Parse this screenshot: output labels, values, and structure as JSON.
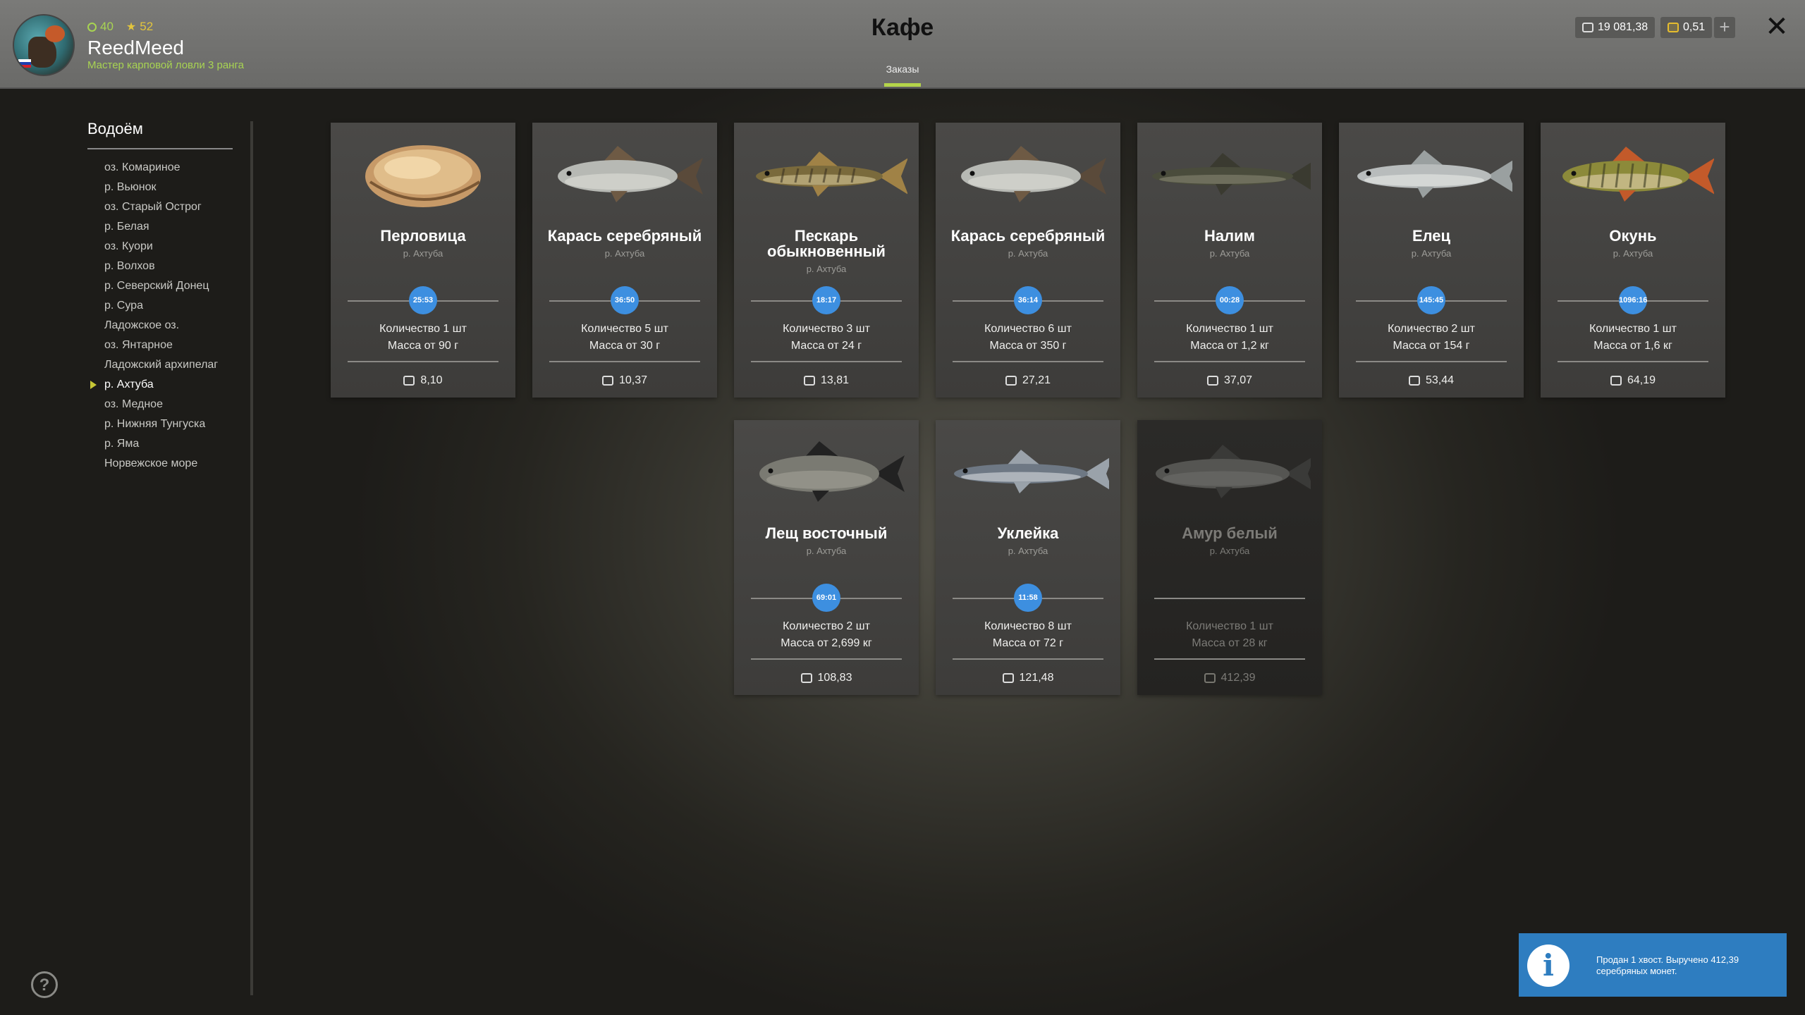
{
  "header": {
    "title": "Кафе",
    "tab_label": "Заказы",
    "player": {
      "level": "40",
      "rating": "52",
      "username": "ReedMeed",
      "rank": "Мастер карповой ловли 3 ранга"
    },
    "silver": "19 081,38",
    "gold": "0,51",
    "plus_label": "+",
    "close_label": "✕"
  },
  "sidebar": {
    "title": "Водоём",
    "items": [
      "оз. Комариное",
      "р. Вьюнок",
      "оз. Старый Острог",
      "р. Белая",
      "оз. Куори",
      "р. Волхов",
      "р. Северский Донец",
      "р. Сура",
      "Ладожское оз.",
      "оз. Янтарное",
      "Ладожский архипелаг",
      "р. Ахтуба",
      "оз. Медное",
      "р. Нижняя Тунгуска",
      "р. Яма",
      "Норвежское море"
    ],
    "active_index": 11
  },
  "orders": [
    {
      "name": "Перловица",
      "location": "р. Ахтуба",
      "timer": "25:53",
      "quantity": "Количество 1 шт",
      "mass": "Масса от 90 г",
      "price": "8,10",
      "image": "mussel-icon"
    },
    {
      "name": "Карась серебряный",
      "location": "р. Ахтуба",
      "timer": "36:50",
      "quantity": "Количество 5 шт",
      "mass": "Масса от 30 г",
      "price": "10,37",
      "image": "fish-icon"
    },
    {
      "name": "Пескарь обыкновенный",
      "location": "р. Ахтуба",
      "timer": "18:17",
      "quantity": "Количество 3 шт",
      "mass": "Масса от 24 г",
      "price": "13,81",
      "image": "fish-icon"
    },
    {
      "name": "Карась серебряный",
      "location": "р. Ахтуба",
      "timer": "36:14",
      "quantity": "Количество 6 шт",
      "mass": "Масса от 350 г",
      "price": "27,21",
      "image": "fish-icon"
    },
    {
      "name": "Налим",
      "location": "р. Ахтуба",
      "timer": "00:28",
      "quantity": "Количество 1 шт",
      "mass": "Масса от 1,2 кг",
      "price": "37,07",
      "image": "fish-icon"
    },
    {
      "name": "Елец",
      "location": "р. Ахтуба",
      "timer": "145:45",
      "quantity": "Количество 2 шт",
      "mass": "Масса от 154 г",
      "price": "53,44",
      "image": "fish-icon"
    },
    {
      "name": "Окунь",
      "location": "р. Ахтуба",
      "timer": "1096:16",
      "quantity": "Количество 1 шт",
      "mass": "Масса от 1,6 кг",
      "price": "64,19",
      "image": "fish-icon"
    },
    {
      "name": "Лещ восточный",
      "location": "р. Ахтуба",
      "timer": "69:01",
      "quantity": "Количество 2 шт",
      "mass": "Масса от 2,699 кг",
      "price": "108,83",
      "image": "fish-icon"
    },
    {
      "name": "Уклейка",
      "location": "р. Ахтуба",
      "timer": "11:58",
      "quantity": "Количество 8 шт",
      "mass": "Масса от 72 г",
      "price": "121,48",
      "image": "fish-icon"
    },
    {
      "name": "Амур белый",
      "location": "р. Ахтуба",
      "timer": "",
      "quantity": "Количество 1 шт",
      "mass": "Масса от 28 кг",
      "price": "412,39",
      "image": "fish-icon",
      "completed": true
    }
  ],
  "notification": {
    "text": "Продан 1 хвост. Выручено 412,39 серебряных монет."
  }
}
